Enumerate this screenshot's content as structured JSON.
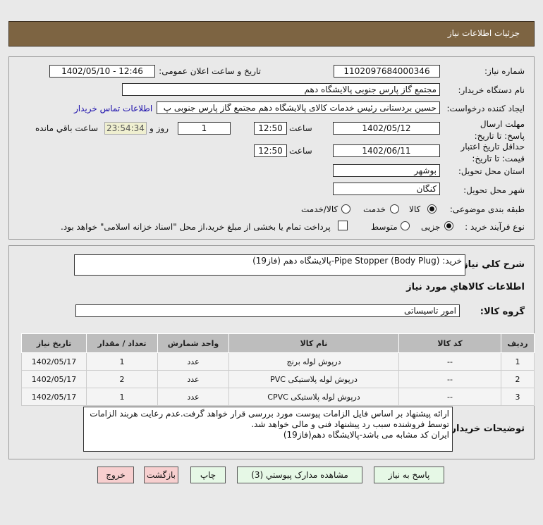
{
  "header": {
    "title": "جزئیات اطلاعات نیاز"
  },
  "form": {
    "need_number_label": "شماره نیاز:",
    "need_number": "1102097684000346",
    "announce_label": "تاریخ و ساعت اعلان عمومی:",
    "announce_value": "1402/05/10 - 12:46",
    "buyer_label": "نام دستگاه خریدار:",
    "buyer_value": "مجتمع گاز پارس جنوبی  پالایشگاه دهم",
    "creator_label": "ایجاد کننده درخواست:",
    "creator_value": "حسین بردستانی رئیس خدمات کالای پالایشگاه دهم مجتمع گاز پارس جنوبی  پ",
    "contact_link": "اطلاعات تماس خریدار",
    "deadline_label": "مهلت ارسال پاسخ: تا تاریخ:",
    "deadline_date": "1402/05/12",
    "time_label": "ساعت",
    "deadline_time": "12:50",
    "days_value": "1",
    "days_label": "روز و",
    "remaining_value": "23:54:34",
    "remaining_label": "ساعت باقي مانده",
    "validity_label": "حداقل تاریخ اعتبار قیمت: تا تاریخ:",
    "validity_date": "1402/06/11",
    "validity_time": "12:50",
    "province_label": "استان محل تحویل:",
    "province_value": "بوشهر",
    "city_label": "شهر محل تحویل:",
    "city_value": "کنگان",
    "category_label": "طبقه بندی موضوعی:",
    "category_options": [
      "کالا",
      "خدمت",
      "کالا/خدمت"
    ],
    "category_selected": "کالا",
    "process_label": "نوع فرآیند خرید :",
    "process_options": [
      "جزیی",
      "متوسط"
    ],
    "process_selected": "جزیی",
    "payment_note": "پرداخت تمام یا بخشی از مبلغ خرید،از محل \"اسناد خزانه اسلامی\" خواهد بود."
  },
  "details": {
    "description_label": "شرح کلي نياز:",
    "description_value": "خرید: Pipe Stopper (Body Plug)-پالایشگاه دهم (فاز19)",
    "goods_title": "اطلاعات کالاهاي مورد نياز",
    "group_label": "گروه کالا:",
    "group_value": "امور تاسیساتی",
    "table": {
      "headers": [
        "ردیف",
        "کد کالا",
        "نام کالا",
        "واحد شمارش",
        "تعداد / مقدار",
        "تاریخ نیاز"
      ],
      "rows": [
        [
          "1",
          "--",
          "درپوش لوله برنج",
          "عدد",
          "1",
          "1402/05/17"
        ],
        [
          "2",
          "--",
          "درپوش لوله پلاستیکی PVC",
          "عدد",
          "2",
          "1402/05/17"
        ],
        [
          "3",
          "--",
          "درپوش لوله پلاستیکی CPVC",
          "عدد",
          "1",
          "1402/05/17"
        ]
      ]
    },
    "notes_label": "توضیحات خریدار:",
    "notes_lines": [
      "ارائه پیشنهاد بر اساس فایل الزامات پیوست مورد بررسی قرار خواهد گرفت.عدم رعایت هربند الزامات",
      "توسط فروشنده سبب رد پیشنهاد فنی و مالی خواهد شد.",
      "ایران کد مشابه می باشد-پالایشگاه دهم(فاز19)"
    ]
  },
  "buttons": {
    "reply": "پاسخ به نیاز",
    "attachments": "مشاهده مدارک پیوستي (3)",
    "print": "چاپ",
    "back": "بازگشت",
    "exit": "خروج"
  },
  "colors": {
    "header": "#7d6442",
    "remaining_bg": "#efefd0",
    "link": "#1a0dab",
    "green_button": "#e6f8e6",
    "red_button": "#f7cfcf"
  }
}
